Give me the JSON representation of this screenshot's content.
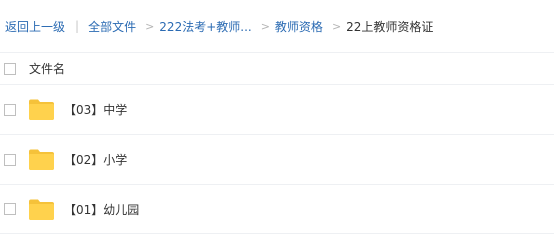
{
  "breadcrumb": {
    "back_label": "返回上一级",
    "items": [
      "全部文件",
      "222法考+教师...",
      "教师资格"
    ],
    "current": "22上教师资格证"
  },
  "table": {
    "header_label": "文件名",
    "rows": [
      {
        "name": "【03】中学",
        "icon": "folder-icon"
      },
      {
        "name": "【02】小学",
        "icon": "folder-icon"
      },
      {
        "name": "【01】幼儿园",
        "icon": "folder-icon"
      }
    ]
  },
  "colors": {
    "link": "#2b6bb3",
    "folder": "#ffd24d",
    "folder_tab": "#f5c23a",
    "divider": "#eef0f3"
  }
}
